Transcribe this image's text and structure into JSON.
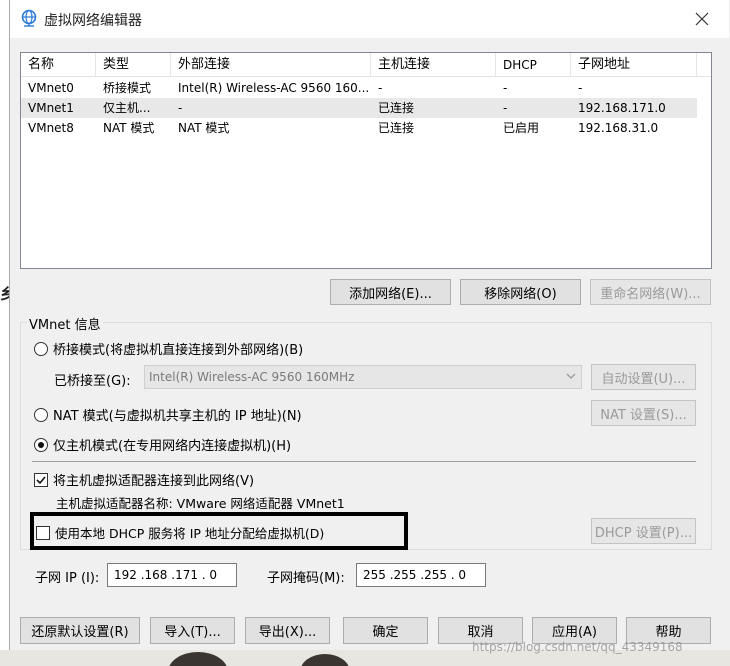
{
  "window": {
    "title": "虚拟网络编辑器"
  },
  "table": {
    "headers": [
      "名称",
      "类型",
      "外部连接",
      "主机连接",
      "DHCP",
      "子网地址"
    ],
    "rows": [
      [
        "VMnet0",
        "桥接模式",
        "Intel(R) Wireless-AC 9560 160...",
        "-",
        "-",
        "-"
      ],
      [
        "VMnet1",
        "仅主机...",
        "-",
        "已连接",
        "-",
        "192.168.171.0"
      ],
      [
        "VMnet8",
        "NAT 模式",
        "NAT 模式",
        "已连接",
        "已启用",
        "192.168.31.0"
      ]
    ],
    "selected_row": 1
  },
  "network_buttons": {
    "add": "添加网络(E)...",
    "remove": "移除网络(O)",
    "rename": "重命名网络(W)..."
  },
  "vmnet_info": {
    "title": "VMnet 信息",
    "bridge_label": "桥接模式(将虚拟机直接连接到外部网络)(B)",
    "bridged_to_label": "已桥接至(G):",
    "bridged_to_value": "Intel(R) Wireless-AC 9560 160MHz",
    "auto_settings": "自动设置(U)...",
    "nat_label": "NAT 模式(与虚拟机共享主机的 IP 地址)(N)",
    "nat_settings": "NAT 设置(S)...",
    "hostonly_label": "仅主机模式(在专用网络内连接虚拟机)(H)",
    "selected_mode": "hostonly",
    "connect_adapter_label": "将主机虚拟适配器连接到此网络(V)",
    "connect_adapter_checked": true,
    "adapter_name_label": "主机虚拟适配器名称: VMware 网络适配器 VMnet1",
    "use_dhcp_label": "使用本地 DHCP 服务将 IP 地址分配给虚拟机(D)",
    "use_dhcp_checked": false,
    "dhcp_settings": "DHCP 设置(P)...",
    "subnet_ip_label": "子网 IP (I):",
    "subnet_ip_value": "192 .168 .171 . 0",
    "subnet_mask_label": "子网掩码(M):",
    "subnet_mask_value": "255 .255 .255 . 0"
  },
  "footer_buttons": {
    "restore": "还原默认设置(R)",
    "import": "导入(T)...",
    "export": "导出(X)...",
    "ok": "确定",
    "cancel": "取消",
    "apply": "应用(A)",
    "help": "帮助"
  },
  "background": {
    "left_mark": "乡",
    "watermark": "https://blog.csdn.net/qq_43349168"
  },
  "colors": {
    "selected_row": "#e8e8e8",
    "disabled_text": "#9a9a9a",
    "button_face": "#e1e1e1"
  }
}
